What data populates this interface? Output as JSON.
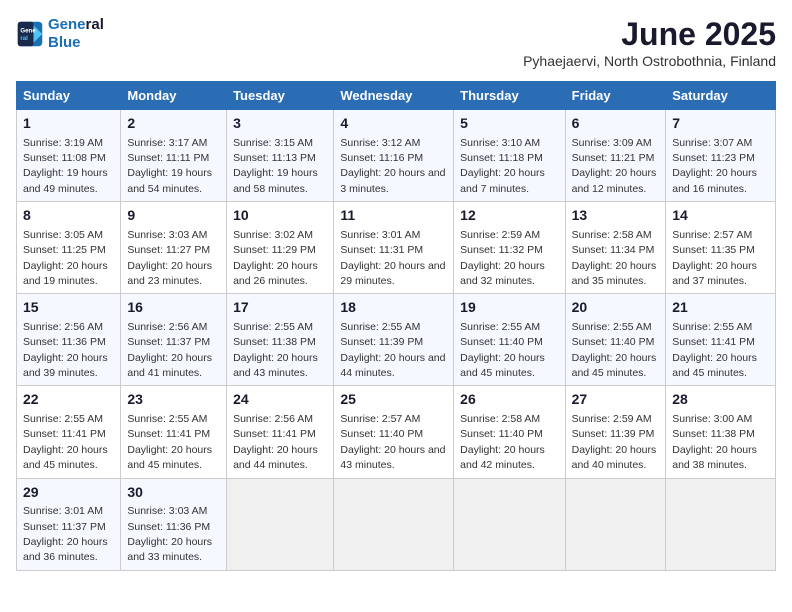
{
  "header": {
    "logo_line1": "General",
    "logo_line2": "Blue",
    "title": "June 2025",
    "subtitle": "Pyhaejaervi, North Ostrobothnia, Finland"
  },
  "calendar": {
    "days_of_week": [
      "Sunday",
      "Monday",
      "Tuesday",
      "Wednesday",
      "Thursday",
      "Friday",
      "Saturday"
    ],
    "weeks": [
      [
        {
          "day": "1",
          "sunrise": "Sunrise: 3:19 AM",
          "sunset": "Sunset: 11:08 PM",
          "daylight": "Daylight: 19 hours and 49 minutes."
        },
        {
          "day": "2",
          "sunrise": "Sunrise: 3:17 AM",
          "sunset": "Sunset: 11:11 PM",
          "daylight": "Daylight: 19 hours and 54 minutes."
        },
        {
          "day": "3",
          "sunrise": "Sunrise: 3:15 AM",
          "sunset": "Sunset: 11:13 PM",
          "daylight": "Daylight: 19 hours and 58 minutes."
        },
        {
          "day": "4",
          "sunrise": "Sunrise: 3:12 AM",
          "sunset": "Sunset: 11:16 PM",
          "daylight": "Daylight: 20 hours and 3 minutes."
        },
        {
          "day": "5",
          "sunrise": "Sunrise: 3:10 AM",
          "sunset": "Sunset: 11:18 PM",
          "daylight": "Daylight: 20 hours and 7 minutes."
        },
        {
          "day": "6",
          "sunrise": "Sunrise: 3:09 AM",
          "sunset": "Sunset: 11:21 PM",
          "daylight": "Daylight: 20 hours and 12 minutes."
        },
        {
          "day": "7",
          "sunrise": "Sunrise: 3:07 AM",
          "sunset": "Sunset: 11:23 PM",
          "daylight": "Daylight: 20 hours and 16 minutes."
        }
      ],
      [
        {
          "day": "8",
          "sunrise": "Sunrise: 3:05 AM",
          "sunset": "Sunset: 11:25 PM",
          "daylight": "Daylight: 20 hours and 19 minutes."
        },
        {
          "day": "9",
          "sunrise": "Sunrise: 3:03 AM",
          "sunset": "Sunset: 11:27 PM",
          "daylight": "Daylight: 20 hours and 23 minutes."
        },
        {
          "day": "10",
          "sunrise": "Sunrise: 3:02 AM",
          "sunset": "Sunset: 11:29 PM",
          "daylight": "Daylight: 20 hours and 26 minutes."
        },
        {
          "day": "11",
          "sunrise": "Sunrise: 3:01 AM",
          "sunset": "Sunset: 11:31 PM",
          "daylight": "Daylight: 20 hours and 29 minutes."
        },
        {
          "day": "12",
          "sunrise": "Sunrise: 2:59 AM",
          "sunset": "Sunset: 11:32 PM",
          "daylight": "Daylight: 20 hours and 32 minutes."
        },
        {
          "day": "13",
          "sunrise": "Sunrise: 2:58 AM",
          "sunset": "Sunset: 11:34 PM",
          "daylight": "Daylight: 20 hours and 35 minutes."
        },
        {
          "day": "14",
          "sunrise": "Sunrise: 2:57 AM",
          "sunset": "Sunset: 11:35 PM",
          "daylight": "Daylight: 20 hours and 37 minutes."
        }
      ],
      [
        {
          "day": "15",
          "sunrise": "Sunrise: 2:56 AM",
          "sunset": "Sunset: 11:36 PM",
          "daylight": "Daylight: 20 hours and 39 minutes."
        },
        {
          "day": "16",
          "sunrise": "Sunrise: 2:56 AM",
          "sunset": "Sunset: 11:37 PM",
          "daylight": "Daylight: 20 hours and 41 minutes."
        },
        {
          "day": "17",
          "sunrise": "Sunrise: 2:55 AM",
          "sunset": "Sunset: 11:38 PM",
          "daylight": "Daylight: 20 hours and 43 minutes."
        },
        {
          "day": "18",
          "sunrise": "Sunrise: 2:55 AM",
          "sunset": "Sunset: 11:39 PM",
          "daylight": "Daylight: 20 hours and 44 minutes."
        },
        {
          "day": "19",
          "sunrise": "Sunrise: 2:55 AM",
          "sunset": "Sunset: 11:40 PM",
          "daylight": "Daylight: 20 hours and 45 minutes."
        },
        {
          "day": "20",
          "sunrise": "Sunrise: 2:55 AM",
          "sunset": "Sunset: 11:40 PM",
          "daylight": "Daylight: 20 hours and 45 minutes."
        },
        {
          "day": "21",
          "sunrise": "Sunrise: 2:55 AM",
          "sunset": "Sunset: 11:41 PM",
          "daylight": "Daylight: 20 hours and 45 minutes."
        }
      ],
      [
        {
          "day": "22",
          "sunrise": "Sunrise: 2:55 AM",
          "sunset": "Sunset: 11:41 PM",
          "daylight": "Daylight: 20 hours and 45 minutes."
        },
        {
          "day": "23",
          "sunrise": "Sunrise: 2:55 AM",
          "sunset": "Sunset: 11:41 PM",
          "daylight": "Daylight: 20 hours and 45 minutes."
        },
        {
          "day": "24",
          "sunrise": "Sunrise: 2:56 AM",
          "sunset": "Sunset: 11:41 PM",
          "daylight": "Daylight: 20 hours and 44 minutes."
        },
        {
          "day": "25",
          "sunrise": "Sunrise: 2:57 AM",
          "sunset": "Sunset: 11:40 PM",
          "daylight": "Daylight: 20 hours and 43 minutes."
        },
        {
          "day": "26",
          "sunrise": "Sunrise: 2:58 AM",
          "sunset": "Sunset: 11:40 PM",
          "daylight": "Daylight: 20 hours and 42 minutes."
        },
        {
          "day": "27",
          "sunrise": "Sunrise: 2:59 AM",
          "sunset": "Sunset: 11:39 PM",
          "daylight": "Daylight: 20 hours and 40 minutes."
        },
        {
          "day": "28",
          "sunrise": "Sunrise: 3:00 AM",
          "sunset": "Sunset: 11:38 PM",
          "daylight": "Daylight: 20 hours and 38 minutes."
        }
      ],
      [
        {
          "day": "29",
          "sunrise": "Sunrise: 3:01 AM",
          "sunset": "Sunset: 11:37 PM",
          "daylight": "Daylight: 20 hours and 36 minutes."
        },
        {
          "day": "30",
          "sunrise": "Sunrise: 3:03 AM",
          "sunset": "Sunset: 11:36 PM",
          "daylight": "Daylight: 20 hours and 33 minutes."
        },
        null,
        null,
        null,
        null,
        null
      ]
    ]
  }
}
